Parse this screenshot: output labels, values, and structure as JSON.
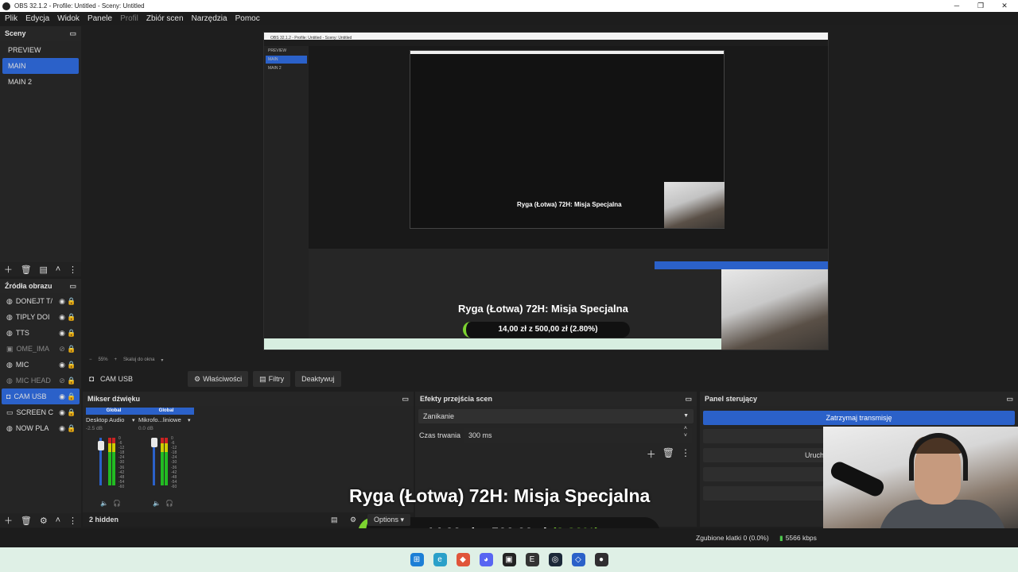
{
  "window": {
    "title": "OBS 32.1.2 - Profile: Untitled - Sceny: Untitled"
  },
  "menu": [
    "Plik",
    "Edycja",
    "Widok",
    "Panele",
    "Profil",
    "Zbiór scen",
    "Narzędzia",
    "Pomoc"
  ],
  "scenes": {
    "header": "Sceny",
    "items": [
      "PREVIEW",
      "MAIN",
      "MAIN 2"
    ],
    "selected": "MAIN"
  },
  "sources": {
    "header": "Źródła obrazu",
    "items": [
      "DONEJT T/",
      "TIPLY DOI",
      "TTS",
      "OME_IMA",
      "MIC",
      "MIC HEAD",
      "CAM USB",
      "SCREEN C",
      "NOW PLA"
    ],
    "selected": "CAM USB"
  },
  "preview": {
    "zoom": "55%",
    "scale_mode": "Skaluj do okna",
    "inner_title": "OBS 32.1.2 - Profile: Untitled - Sceny: Untitled",
    "inner_ryga": "Ryga (Łotwa) 72H: Misja Specjalna",
    "inner_amount": "14,00 zł z 500,00 zł (2.80%)"
  },
  "context": {
    "source": "CAM USB",
    "props": "Właściwości",
    "filters": "Filtry",
    "deactivate": "Deaktywuj"
  },
  "mixer": {
    "header": "Mikser dźwięku",
    "channels": [
      {
        "global": "Global",
        "name": "Desktop Audio",
        "db": "-2.5 dB"
      },
      {
        "global": "Global",
        "name": "Mikrofo...liniowe",
        "db": "0.0 dB"
      }
    ],
    "scale": [
      "0",
      "-6",
      "-12",
      "-18",
      "-24",
      "-30",
      "-36",
      "-42",
      "-48",
      "-54",
      "-60"
    ],
    "hidden": "2 hidden"
  },
  "transitions": {
    "header": "Efekty przejścia scen",
    "effect": "Zanikanie",
    "duration_label": "Czas trwania",
    "duration": "300 ms"
  },
  "controls": {
    "header": "Panel sterujący",
    "stop_stream": "Zatrzymaj transmisję",
    "start_label": "Uruch"
  },
  "overlay": {
    "title": "Ryga (Łotwa) 72H: Misja Specjalna",
    "amount": "14,00 zł",
    "z": "z",
    "goal": "500,00 zł",
    "pct": "(2.80%)",
    "options": "Options"
  },
  "status": {
    "dropped": "Zgubione klatki 0 (0.0%)",
    "kbps": "5566 kbps"
  }
}
